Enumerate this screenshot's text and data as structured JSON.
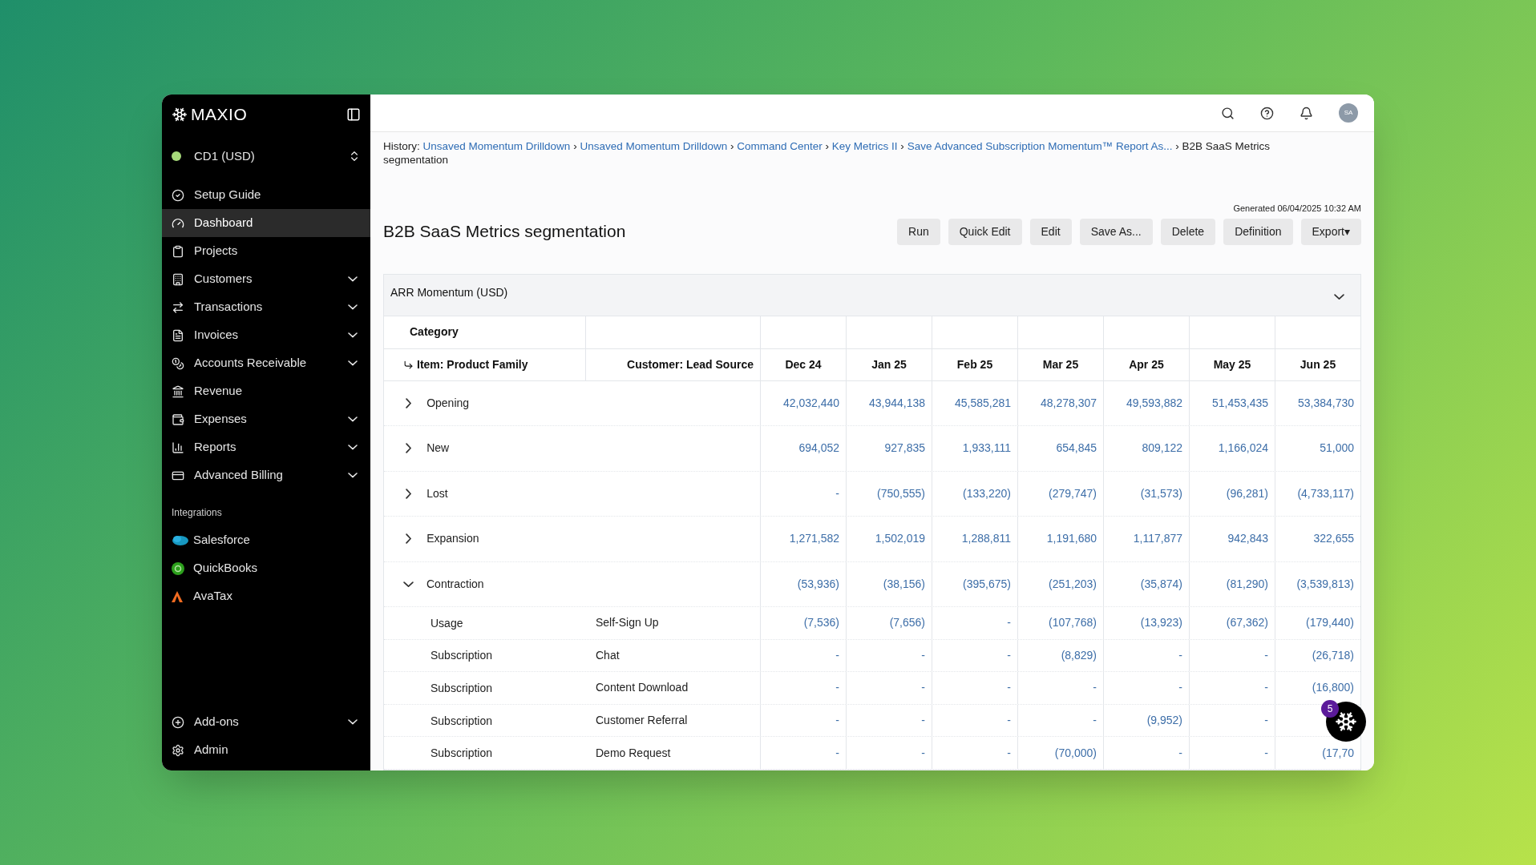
{
  "brand": {
    "name": "MAXIO"
  },
  "entity": {
    "label": "CD1 (USD)",
    "color": "#a6d97a"
  },
  "sidebar": {
    "items": [
      {
        "label": "Setup Guide",
        "expandable": false,
        "selected": false
      },
      {
        "label": "Dashboard",
        "expandable": false,
        "selected": true
      },
      {
        "label": "Projects",
        "expandable": false,
        "selected": false
      },
      {
        "label": "Customers",
        "expandable": true,
        "selected": false
      },
      {
        "label": "Transactions",
        "expandable": true,
        "selected": false
      },
      {
        "label": "Invoices",
        "expandable": true,
        "selected": false
      },
      {
        "label": "Accounts Receivable",
        "expandable": true,
        "selected": false
      },
      {
        "label": "Revenue",
        "expandable": false,
        "selected": false
      },
      {
        "label": "Expenses",
        "expandable": true,
        "selected": false
      },
      {
        "label": "Reports",
        "expandable": true,
        "selected": false
      },
      {
        "label": "Advanced Billing",
        "expandable": true,
        "selected": false
      }
    ],
    "section_title": "Integrations",
    "integrations": [
      {
        "label": "Salesforce"
      },
      {
        "label": "QuickBooks"
      },
      {
        "label": "AvaTax"
      }
    ],
    "footer_items": [
      {
        "label": "Add-ons",
        "expandable": true
      },
      {
        "label": "Admin",
        "expandable": false
      }
    ]
  },
  "topbar": {
    "avatar": "SA"
  },
  "breadcrumb": {
    "label": "History:",
    "separator": "›",
    "items": [
      {
        "text": "Unsaved Momentum Drilldown",
        "kind": "link"
      },
      {
        "text": "Unsaved Momentum Drilldown",
        "kind": "link"
      },
      {
        "text": "Command Center",
        "kind": "link"
      },
      {
        "text": "Key Metrics II",
        "kind": "link"
      },
      {
        "text": "Save Advanced Subscription Momentum™ Report As...",
        "kind": "link"
      },
      {
        "text": "B2B SaaS Metrics segmentation",
        "kind": "current"
      }
    ]
  },
  "report": {
    "title": "B2B SaaS Metrics segmentation",
    "generated": "Generated 06/04/2025 10:32 AM",
    "actions": [
      "Run",
      "Quick Edit",
      "Edit",
      "Save As...",
      "Delete",
      "Definition",
      "Export▾"
    ]
  },
  "table": {
    "title": "ARR Momentum (USD)",
    "expanded": true,
    "category_header": "Category",
    "columns": [
      "Item: Product Family",
      "Customer: Lead Source",
      "Dec 24",
      "Jan 25",
      "Feb 25",
      "Mar 25",
      "Apr 25",
      "May 25",
      "Jun 25"
    ],
    "rows": [
      {
        "kind": "group",
        "label": "Opening",
        "expanded": false,
        "values": [
          "42,032,440",
          "43,944,138",
          "45,585,281",
          "48,278,307",
          "49,593,882",
          "51,453,435",
          "53,384,730"
        ]
      },
      {
        "kind": "group",
        "label": "New",
        "expanded": false,
        "values": [
          "694,052",
          "927,835",
          "1,933,111",
          "654,845",
          "809,122",
          "1,166,024",
          "51,000"
        ]
      },
      {
        "kind": "group",
        "label": "Lost",
        "expanded": false,
        "values": [
          "-",
          "(750,555)",
          "(133,220)",
          "(279,747)",
          "(31,573)",
          "(96,281)",
          "(4,733,117)"
        ]
      },
      {
        "kind": "group",
        "label": "Expansion",
        "expanded": false,
        "values": [
          "1,271,582",
          "1,502,019",
          "1,288,811",
          "1,191,680",
          "1,117,877",
          "942,843",
          "322,655"
        ]
      },
      {
        "kind": "group",
        "label": "Contraction",
        "expanded": true,
        "values": [
          "(53,936)",
          "(38,156)",
          "(395,675)",
          "(251,203)",
          "(35,874)",
          "(81,290)",
          "(3,539,813)"
        ]
      },
      {
        "kind": "detail",
        "item": "Usage",
        "source": "Self-Sign Up",
        "values": [
          "(7,536)",
          "(7,656)",
          "-",
          "(107,768)",
          "(13,923)",
          "(67,362)",
          "(179,440)"
        ]
      },
      {
        "kind": "detail",
        "item": "Subscription",
        "source": "Chat",
        "values": [
          "-",
          "-",
          "-",
          "(8,829)",
          "-",
          "-",
          "(26,718)"
        ]
      },
      {
        "kind": "detail",
        "item": "Subscription",
        "source": "Content Download",
        "values": [
          "-",
          "-",
          "-",
          "-",
          "-",
          "-",
          "(16,800)"
        ]
      },
      {
        "kind": "detail",
        "item": "Subscription",
        "source": "Customer Referral",
        "values": [
          "-",
          "-",
          "-",
          "-",
          "(9,952)",
          "-"
        ]
      },
      {
        "kind": "detail",
        "item": "Subscription",
        "source": "Demo Request",
        "values": [
          "-",
          "-",
          "-",
          "(70,000)",
          "-",
          "-",
          "(17,70"
        ]
      }
    ]
  },
  "chat": {
    "badge": "5"
  }
}
